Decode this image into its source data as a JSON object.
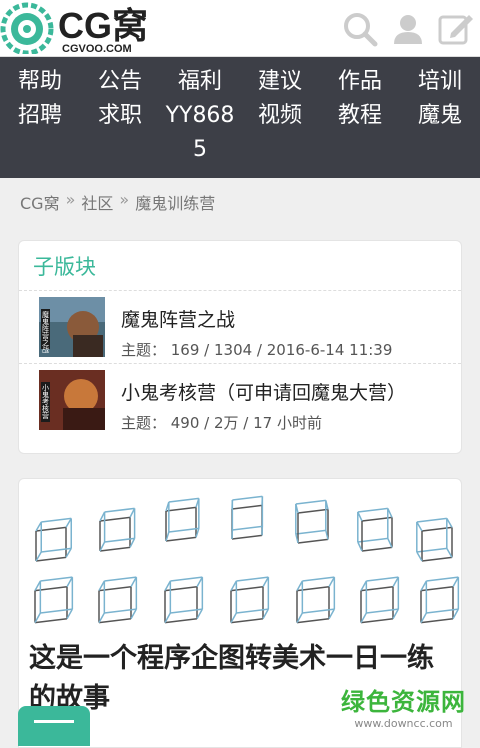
{
  "header": {
    "logo_text": "CG窝",
    "logo_sub": "CGVOO.COM",
    "icons": [
      "search-icon",
      "user-icon",
      "edit-icon"
    ]
  },
  "nav": {
    "columns": [
      {
        "top": "帮助",
        "bottom": "招聘"
      },
      {
        "top": "公告",
        "bottom": "求职"
      },
      {
        "top": "福利",
        "bottom": "YY8685"
      },
      {
        "top": "建议",
        "bottom": "视频"
      },
      {
        "top": "作品",
        "bottom": "教程"
      },
      {
        "top": "培训",
        "bottom": "魔鬼"
      }
    ]
  },
  "breadcrumb": {
    "items": [
      "CG窝",
      "社区",
      "魔鬼训练营"
    ],
    "separator": "»"
  },
  "subforums": {
    "title": "子版块",
    "items": [
      {
        "name": "魔鬼阵营之战",
        "meta": "主题： 169 / 1304 / 2016-6-14 11:39",
        "thumb_text": "魔鬼阵营之战"
      },
      {
        "name": "小鬼考核营（可申请回魔鬼大营）",
        "meta": "主题： 490 / 2万 / 17 小时前",
        "thumb_text": "小鬼考核营"
      }
    ]
  },
  "article": {
    "title": "这是一个程序企图转美术一日一练的故事"
  },
  "watermark": {
    "big": "绿色资源网",
    "small": "www.downcc.com"
  },
  "colors": {
    "accent": "#3bb89a",
    "nav_bg": "#3d3f47",
    "watermark": "#3cb53c"
  }
}
